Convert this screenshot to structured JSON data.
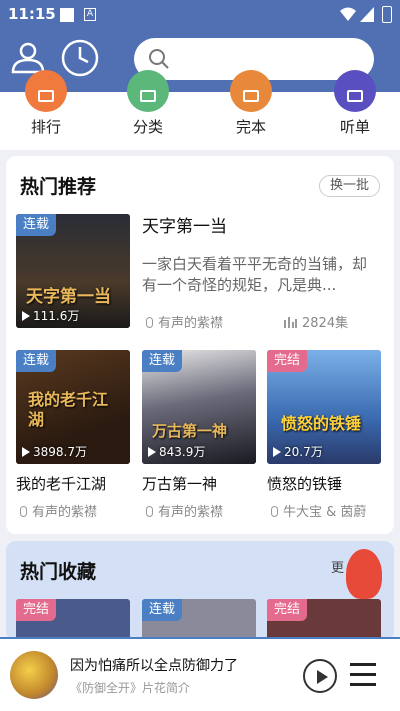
{
  "status": {
    "time": "11:15",
    "notif_glyph": "A"
  },
  "search": {
    "placeholder": ""
  },
  "quicknav": [
    {
      "label": "排行",
      "color": "#f07a3e",
      "icon": "rank-icon"
    },
    {
      "label": "分类",
      "color": "#5cb87a",
      "icon": "grid-icon"
    },
    {
      "label": "完本",
      "color": "#e8883a",
      "icon": "book-icon"
    },
    {
      "label": "听单",
      "color": "#5a4fc0",
      "icon": "edit-icon"
    }
  ],
  "hot": {
    "title": "热门推荐",
    "batch_label": "换一批",
    "featured": {
      "tag": "连载",
      "plays": "111.6万",
      "art_text": "天字第一当",
      "title": "天字第一当",
      "desc": "一家白天看着平平无奇的当铺，却有一个奇怪的规矩，凡是典...",
      "narrator": "有声的紫襟",
      "episodes": "2824集"
    },
    "books": [
      {
        "tag": "连载",
        "plays": "3898.7万",
        "art_text": "我的老千江湖",
        "title": "我的老千江湖",
        "author": "有声的紫襟",
        "color": "#3a2a20"
      },
      {
        "tag": "连载",
        "plays": "843.9万",
        "art_text": "万古第一神",
        "title": "万古第一神",
        "author": "有声的紫襟",
        "color": "#2b2a36"
      },
      {
        "tag": "完结",
        "plays": "20.7万",
        "art_text": "愤怒的铁锤",
        "title": "愤怒的铁锤",
        "author": "牛大宝 & 茵蔚",
        "color": "#4a7ec8"
      }
    ]
  },
  "fav": {
    "title": "热门收藏",
    "more_label": "更",
    "tags": [
      "完结",
      "连载",
      "完结"
    ]
  },
  "player": {
    "title": "因为怕痛所以全点防御力了",
    "subtitle": "《防御全开》片花简介"
  }
}
